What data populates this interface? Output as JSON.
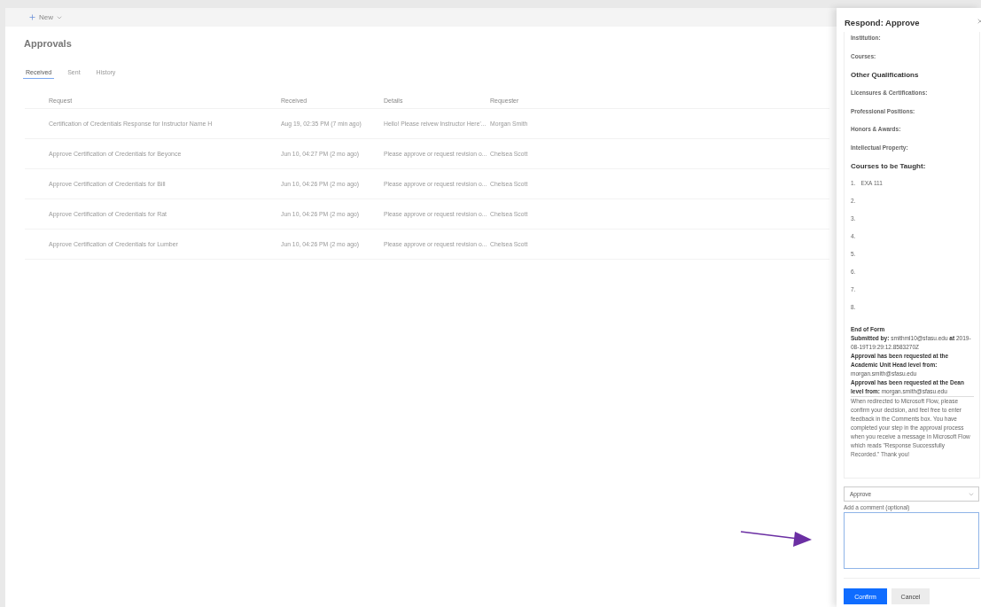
{
  "toolbar": {
    "new_button": "New"
  },
  "page_title": "Approvals",
  "tabs": [
    {
      "label": "Received",
      "selected": true
    },
    {
      "label": "Sent",
      "selected": false
    },
    {
      "label": "History",
      "selected": false
    }
  ],
  "table": {
    "columns": [
      "Request",
      "Received",
      "Details",
      "Requester"
    ],
    "rows": [
      {
        "request": "Certification of Credentials Response for Instructor Name H",
        "received": "Aug 19, 02:35 PM (7 min ago)",
        "details": "Hello! Please reivew Instructor Here'...",
        "requester": "Morgan Smith"
      },
      {
        "request": "Approve Certification of Credentials for Beyonce",
        "received": "Jun 10, 04:27 PM (2 mo ago)",
        "details": "Please approve or request revision o...",
        "requester": "Chelsea Scott"
      },
      {
        "request": "Approve Certification of Credentials for Bill",
        "received": "Jun 10, 04:26 PM (2 mo ago)",
        "details": "Please approve or request revision o...",
        "requester": "Chelsea Scott"
      },
      {
        "request": "Approve Certification of Credentials for Rat",
        "received": "Jun 10, 04:26 PM (2 mo ago)",
        "details": "Please approve or request revision o...",
        "requester": "Chelsea Scott"
      },
      {
        "request": "Approve Certification of Credentials for Lumber",
        "received": "Jun 10, 04:26 PM (2 mo ago)",
        "details": "Please approve or request revision o...",
        "requester": "Chelsea Scott"
      }
    ]
  },
  "panel": {
    "title": "Respond: Approve",
    "form": [
      {
        "kind": "field",
        "text": "Institution:"
      },
      {
        "kind": "field",
        "text": "Courses:"
      },
      {
        "kind": "heading",
        "text": "Other Qualifications"
      },
      {
        "kind": "field",
        "text": "Licensures & Certifications:"
      },
      {
        "kind": "field",
        "text": "Professional Positions:"
      },
      {
        "kind": "field",
        "text": "Honors & Awards:"
      },
      {
        "kind": "field",
        "text": "Intellectual Property:"
      },
      {
        "kind": "heading",
        "text": "Courses to be Taught:"
      },
      {
        "kind": "numbered",
        "number": "1.",
        "text": "EXA  111"
      },
      {
        "kind": "numbered",
        "number": "2."
      },
      {
        "kind": "numbered",
        "number": "3."
      },
      {
        "kind": "numbered",
        "number": "4."
      },
      {
        "kind": "numbered",
        "number": "5."
      },
      {
        "kind": "numbered",
        "number": "6."
      },
      {
        "kind": "numbered",
        "number": "7."
      },
      {
        "kind": "numbered",
        "number": "8."
      }
    ],
    "summary": [
      "**End of Form**",
      "**Submitted by:** smithml10@sfasu.edu **at** 2019-08-19T19:29:12.8583270Z",
      "**Approval has been requested at the Academic Unit Head level from:** morgan.smith@sfasu.edu",
      "**Approval has been requested at the Dean level from:** morgan.smith@sfasu.edu"
    ],
    "message": "When redirected to Microsoft Flow, please confirm your decision, and feel free to enter feedback in the Comments box. You have completed your step in the approval process when you receive a message in Microsoft Flow which reads \"Response Successfully Recorded.\" Thank you!",
    "response_select": "Approve",
    "comment_label": "Add a comment (optional)",
    "buttons": [
      {
        "label": "Confirm",
        "kind": "primary"
      },
      {
        "label": "Cancel",
        "kind": "secondary"
      }
    ]
  }
}
